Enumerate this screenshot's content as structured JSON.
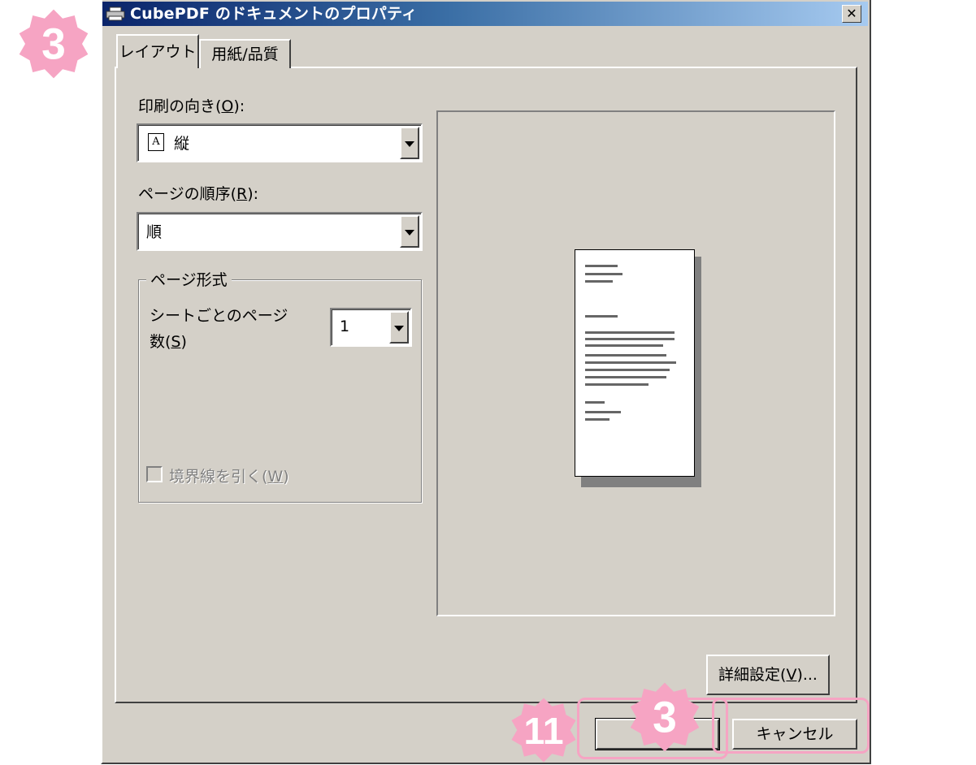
{
  "window": {
    "title": "CubePDF のドキュメントのプロパティ",
    "close_glyph": "✕"
  },
  "tabs": [
    {
      "label": "レイアウト",
      "active": true
    },
    {
      "label": "用紙/品質",
      "active": false
    }
  ],
  "orientation": {
    "label": "印刷の向き(",
    "accel": "O",
    "label_end": "):",
    "value": "縦",
    "value_icon": "A"
  },
  "page_order": {
    "label": "ページの順序(",
    "accel": "R",
    "label_end": "):",
    "value": "順"
  },
  "page_format": {
    "group_title": "ページ形式",
    "pages_per_sheet_label_1": "シートごとのページ",
    "pages_per_sheet_label_2": "数(",
    "pages_per_sheet_accel": "S",
    "pages_per_sheet_end": ")",
    "pages_per_sheet_value": "1",
    "borders_label": "境界線を引く(",
    "borders_accel": "W",
    "borders_end": ")",
    "borders_checked": false
  },
  "buttons": {
    "advanced_label": "詳細設定(",
    "advanced_accel": "V",
    "advanced_end": ")...",
    "ok_label": "",
    "cancel_label": "キャンセル"
  },
  "annotations": {
    "badge_top_left": "3",
    "badge_bottom_center": "3",
    "badge_bottom_left": "11",
    "color": "#f6a4c3"
  }
}
